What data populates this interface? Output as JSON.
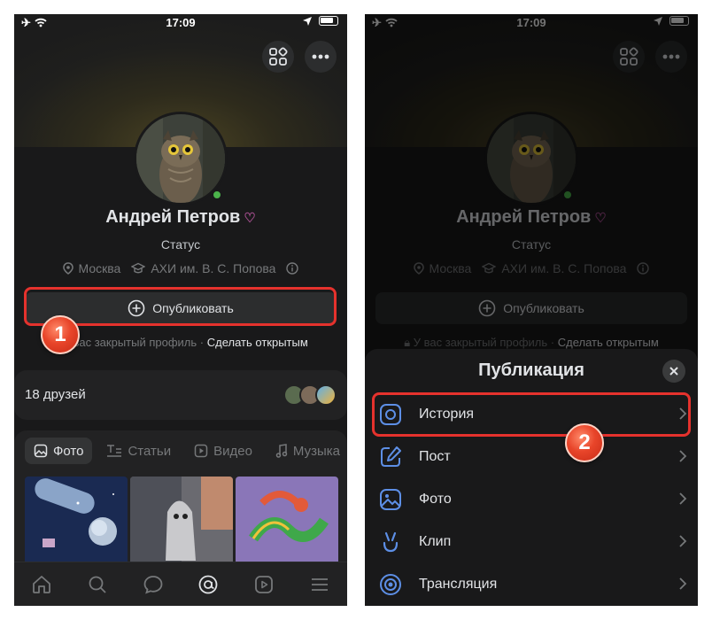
{
  "status_bar": {
    "time": "17:09"
  },
  "profile": {
    "name": "Андрей Петров",
    "status": "Статус",
    "city": "Москва",
    "university": "АХИ им. В. С. Попова",
    "publish_label": "Опубликовать",
    "closed_text": "У вас закрытый профиль",
    "closed_separator": "·",
    "make_open_label": "Сделать открытым"
  },
  "friends": {
    "label": "18 друзей"
  },
  "media_tabs": [
    "Фото",
    "Статьи",
    "Видео",
    "Музыка"
  ],
  "nav_icons": [
    "home-icon",
    "search-icon",
    "messages-icon",
    "profile-icon",
    "video-icon",
    "menu-icon"
  ],
  "sheet": {
    "title": "Публикация",
    "items": [
      {
        "label": "История",
        "icon": "story-icon"
      },
      {
        "label": "Пост",
        "icon": "post-icon"
      },
      {
        "label": "Фото",
        "icon": "photo-icon"
      },
      {
        "label": "Клип",
        "icon": "clip-icon"
      },
      {
        "label": "Трансляция",
        "icon": "broadcast-icon"
      }
    ]
  },
  "annotations": {
    "step1": "1",
    "step2": "2"
  },
  "colors": {
    "accent": "#5d8fe6",
    "highlight": "#e5322d",
    "online": "#4bb34b",
    "background": "#19191a"
  }
}
